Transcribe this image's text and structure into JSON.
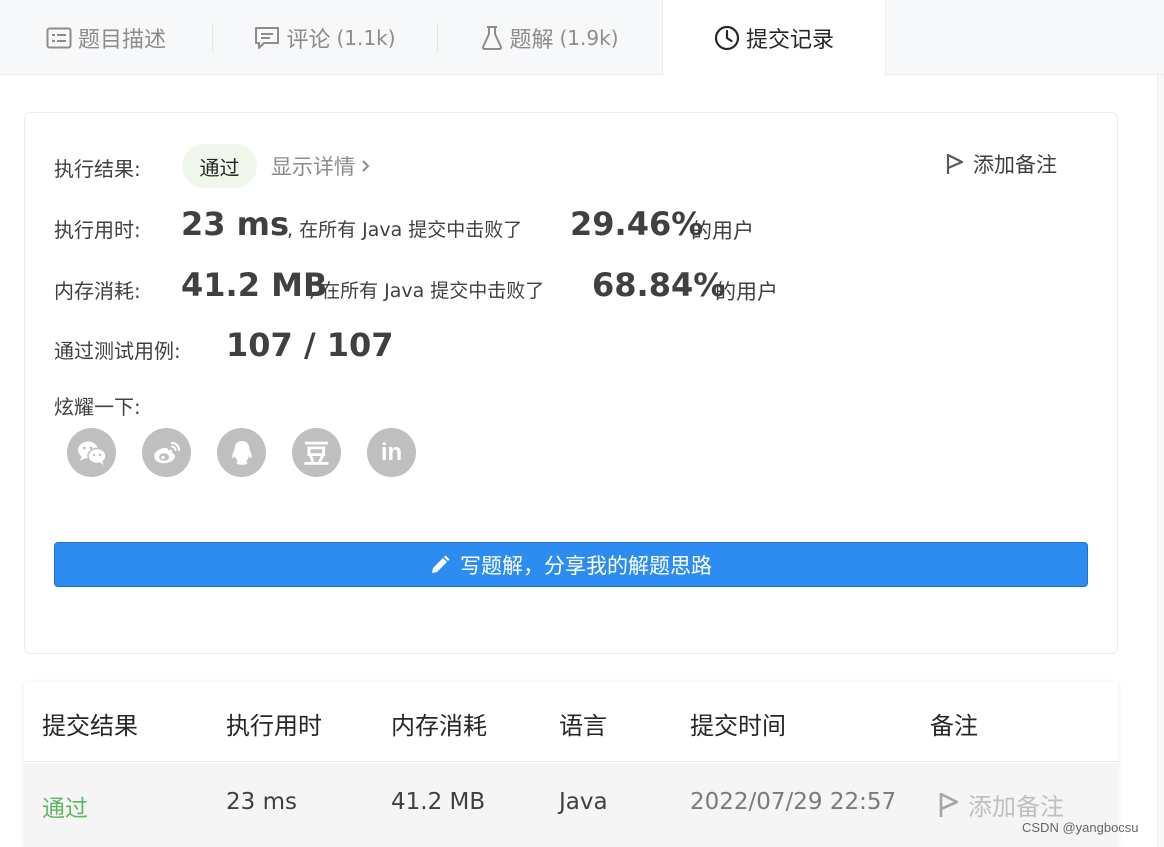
{
  "tabs": [
    {
      "label": "题目描述",
      "count": "",
      "icon": "description-icon"
    },
    {
      "label": "评论",
      "count": "(1.1k)",
      "icon": "comment-icon"
    },
    {
      "label": "题解",
      "count": "(1.9k)",
      "icon": "flask-icon"
    },
    {
      "label": "提交记录",
      "count": "",
      "icon": "clock-icon"
    }
  ],
  "result": {
    "status_label": "执行结果:",
    "status_value": "通过",
    "detail_link": "显示详情",
    "add_note": "添加备注",
    "runtime_label": "执行用时:",
    "runtime_value": "23 ms",
    "runtime_beat_prefix": ", 在所有 Java 提交中击败了",
    "runtime_percent": "29.46%",
    "runtime_suffix": "的用户",
    "memory_label": "内存消耗:",
    "memory_value": "41.2 MB",
    "memory_beat_prefix": ", 在所有 Java 提交中击败了",
    "memory_percent": "68.84%",
    "memory_suffix": "的用户",
    "tests_label": "通过测试用例:",
    "tests_value": "107 / 107",
    "share_label": "炫耀一下:",
    "share_icons": [
      "wechat-icon",
      "weibo-icon",
      "qq-icon",
      "douban-icon",
      "linkedin-icon"
    ],
    "douban_glyph": "豆",
    "linkedin_glyph": "in",
    "write_button": "写题解，分享我的解题思路"
  },
  "table": {
    "headers": [
      "提交结果",
      "执行用时",
      "内存消耗",
      "语言",
      "提交时间",
      "备注"
    ],
    "rows": [
      {
        "result": "通过",
        "runtime": "23 ms",
        "memory": "41.2 MB",
        "language": "Java",
        "time": "2022/07/29 22:57",
        "note": "添加备注"
      }
    ]
  },
  "watermark": "CSDN @yangbocsu",
  "colors": {
    "accent": "#2d8cf0",
    "pass": "#5cb85c",
    "share_gray": "#bfbfbf"
  }
}
